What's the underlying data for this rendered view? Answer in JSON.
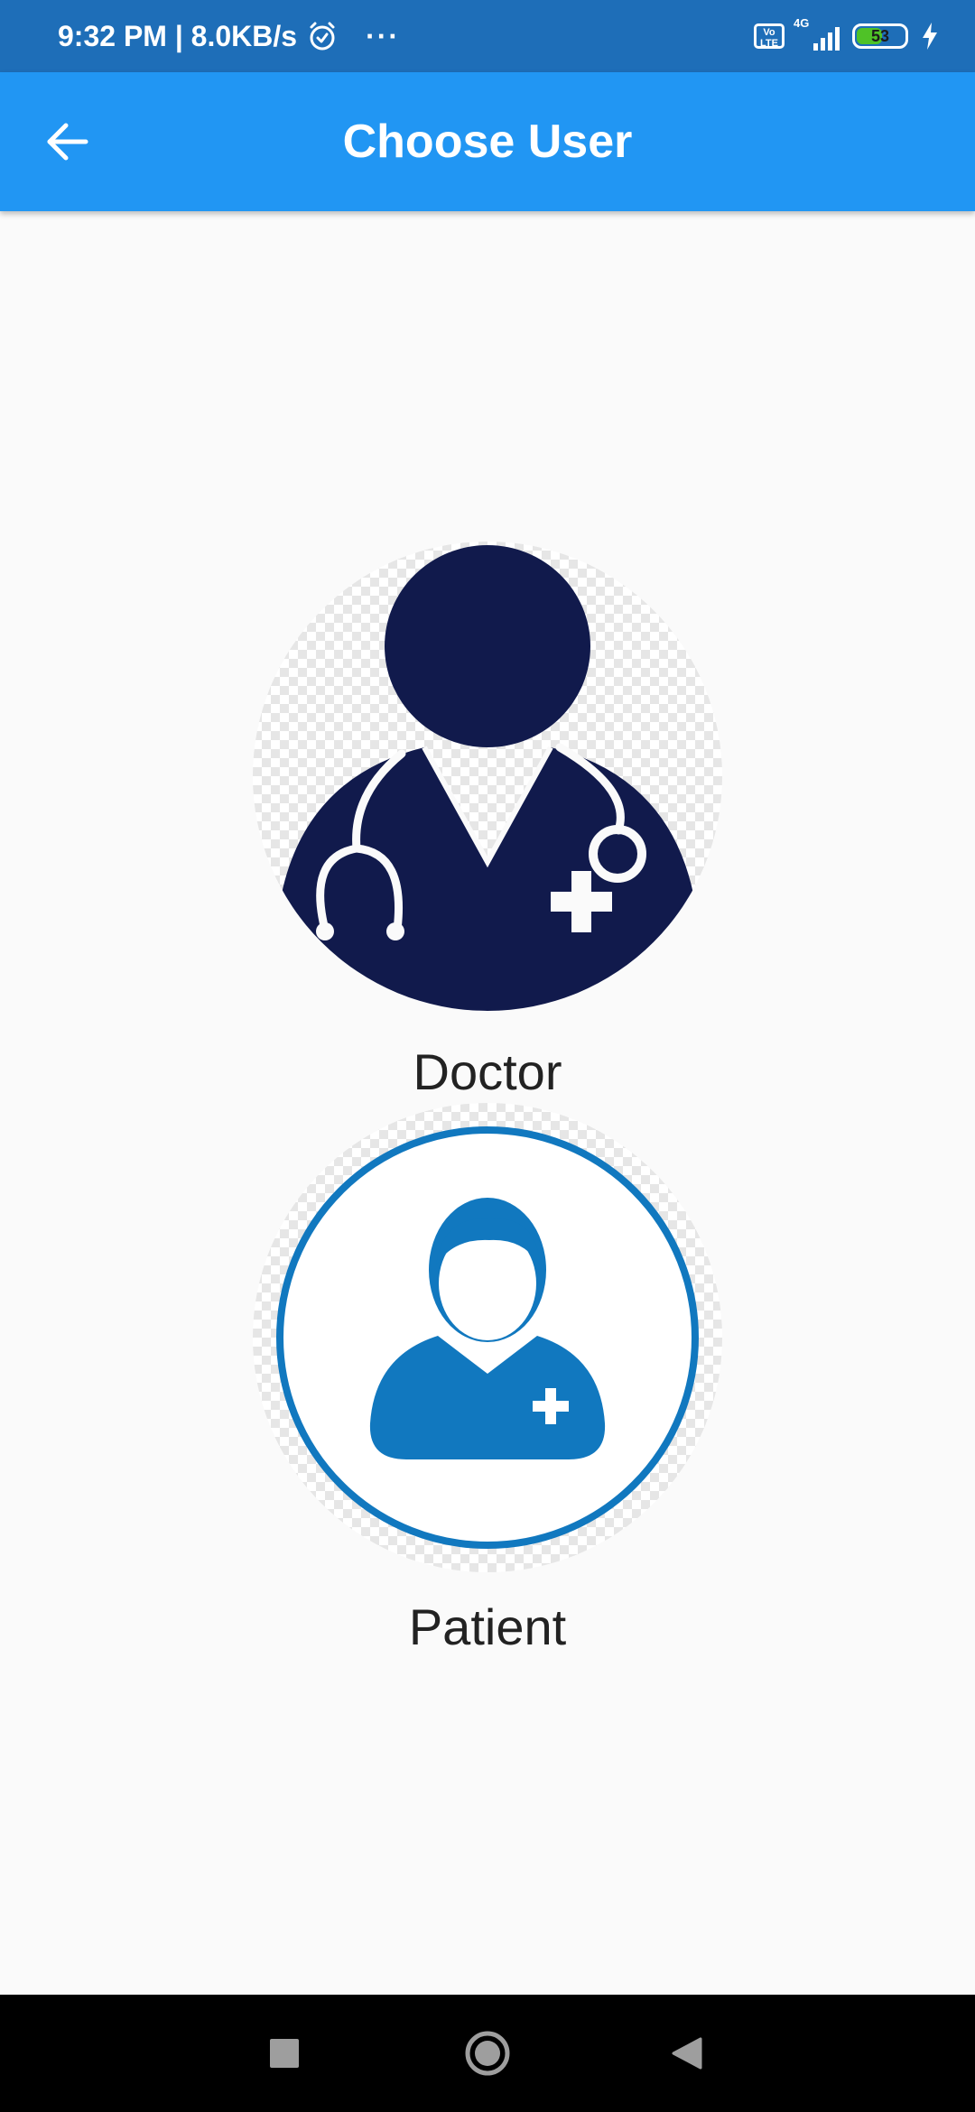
{
  "status_bar": {
    "time_speed": "9:32 PM | 8.0KB/s",
    "more_indicator": "···",
    "volte_label": "Vo LTE",
    "network_label": "4G",
    "battery_percent": "53",
    "battery_level": 0.53,
    "icons": [
      "alarm-icon",
      "volte-icon",
      "signal-icon",
      "battery-icon",
      "charging-icon"
    ]
  },
  "header": {
    "title": "Choose User",
    "back_icon": "arrow-left-icon"
  },
  "options": [
    {
      "label": "Doctor",
      "icon": "doctor-avatar-icon"
    },
    {
      "label": "Patient",
      "icon": "patient-avatar-icon"
    }
  ],
  "nav_bar": {
    "icons": [
      "recents-square-icon",
      "home-circle-icon",
      "back-triangle-icon"
    ]
  },
  "colors": {
    "status_bar": "#1e6eb8",
    "app_bar": "#2196f3",
    "doctor_navy": "#111a4c",
    "patient_blue": "#1178bf",
    "background": "#fafafa"
  }
}
